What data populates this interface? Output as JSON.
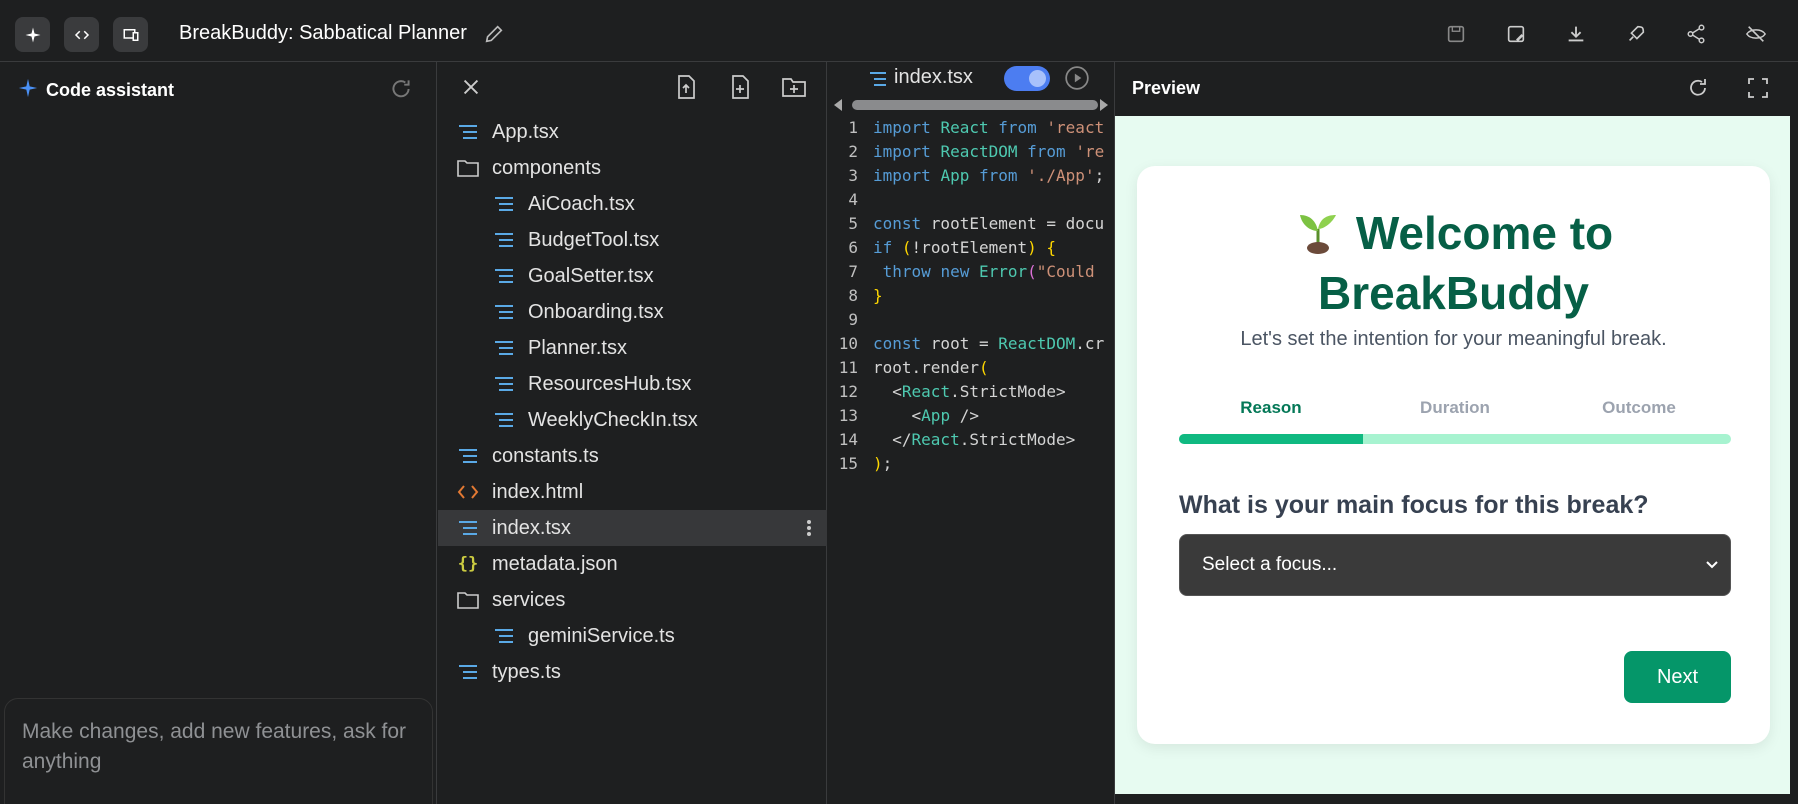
{
  "topbar": {
    "app_title": "BreakBuddy: Sabbatical Planner",
    "left_icons": [
      "sparkle-icon",
      "code-icon",
      "devices-icon"
    ],
    "right_icons": [
      "save-icon",
      "save-as-icon",
      "download-icon",
      "deploy-rocket-icon",
      "share-icon",
      "hide-icon"
    ]
  },
  "assistant": {
    "title": "Code assistant",
    "prompt_placeholder": "Make changes, add new features, ask for anything"
  },
  "file_tree": {
    "items": [
      {
        "name": "App.tsx",
        "type": "file-tsx",
        "depth": 0
      },
      {
        "name": "components",
        "type": "folder",
        "depth": 0
      },
      {
        "name": "AiCoach.tsx",
        "type": "file-tsx",
        "depth": 1
      },
      {
        "name": "BudgetTool.tsx",
        "type": "file-tsx",
        "depth": 1
      },
      {
        "name": "GoalSetter.tsx",
        "type": "file-tsx",
        "depth": 1
      },
      {
        "name": "Onboarding.tsx",
        "type": "file-tsx",
        "depth": 1
      },
      {
        "name": "Planner.tsx",
        "type": "file-tsx",
        "depth": 1
      },
      {
        "name": "ResourcesHub.tsx",
        "type": "file-tsx",
        "depth": 1
      },
      {
        "name": "WeeklyCheckIn.tsx",
        "type": "file-tsx",
        "depth": 1
      },
      {
        "name": "constants.ts",
        "type": "file-tsx",
        "depth": 0
      },
      {
        "name": "index.html",
        "type": "file-html",
        "depth": 0
      },
      {
        "name": "index.tsx",
        "type": "file-tsx",
        "depth": 0,
        "selected": true
      },
      {
        "name": "metadata.json",
        "type": "file-json",
        "depth": 0
      },
      {
        "name": "services",
        "type": "folder",
        "depth": 0
      },
      {
        "name": "geminiService.ts",
        "type": "file-tsx",
        "depth": 1
      },
      {
        "name": "types.ts",
        "type": "file-tsx",
        "depth": 0
      }
    ]
  },
  "editor": {
    "tab_name": "index.tsx",
    "lines": [
      [
        [
          "kw",
          "import "
        ],
        [
          "ty",
          "React "
        ],
        [
          "kw",
          "from "
        ],
        [
          "st",
          "'react"
        ]
      ],
      [
        [
          "kw",
          "import "
        ],
        [
          "ty",
          "ReactDOM "
        ],
        [
          "kw",
          "from "
        ],
        [
          "st",
          "'re"
        ]
      ],
      [
        [
          "kw",
          "import "
        ],
        [
          "ty",
          "App "
        ],
        [
          "kw",
          "from "
        ],
        [
          "st",
          "'./App'"
        ],
        [
          "",
          "; "
        ]
      ],
      [],
      [
        [
          "kw",
          "const "
        ],
        [
          "",
          "rootElement = docu"
        ]
      ],
      [
        [
          "kw",
          "if "
        ],
        [
          "br",
          "("
        ],
        [
          "",
          "!rootElement"
        ],
        [
          "br",
          ")"
        ],
        [
          "",
          " "
        ],
        [
          "br",
          "{"
        ]
      ],
      [
        [
          "",
          " "
        ],
        [
          "kw",
          "throw new "
        ],
        [
          "ty",
          "Error"
        ],
        [
          "pn",
          "("
        ],
        [
          "st",
          "\"Could"
        ]
      ],
      [
        [
          "br",
          "}"
        ]
      ],
      [],
      [
        [
          "kw",
          "const "
        ],
        [
          "",
          "root = "
        ],
        [
          "ty",
          "ReactDOM"
        ],
        [
          "",
          ".cr"
        ]
      ],
      [
        [
          "",
          "root.render"
        ],
        [
          "br",
          "("
        ]
      ],
      [
        [
          "",
          "  <"
        ],
        [
          "ty",
          "React"
        ],
        [
          "",
          ".StrictMode>"
        ]
      ],
      [
        [
          "",
          "    <"
        ],
        [
          "ty",
          "App"
        ],
        [
          "",
          " />"
        ]
      ],
      [
        [
          "",
          "  </"
        ],
        [
          "ty",
          "React"
        ],
        [
          "",
          ".StrictMode>"
        ]
      ],
      [
        [
          "br",
          ")"
        ],
        [
          "",
          ";"
        ]
      ]
    ]
  },
  "preview": {
    "title": "Preview",
    "welcome_line1": "Welcome to",
    "welcome_line2": "BreakBuddy",
    "subtitle": "Let's set the intention for your meaningful break.",
    "steps": [
      "Reason",
      "Duration",
      "Outcome"
    ],
    "active_step": 0,
    "progress_fraction": 0.333,
    "question": "What is your main focus for this break?",
    "select_value": "Select a focus...",
    "next_label": "Next"
  },
  "colors": {
    "accent_green": "#059669",
    "heading_green": "#065f46",
    "progress_fill": "#10b981",
    "progress_bg": "#a7f3d0",
    "toggle_blue": "#4c7df1"
  }
}
